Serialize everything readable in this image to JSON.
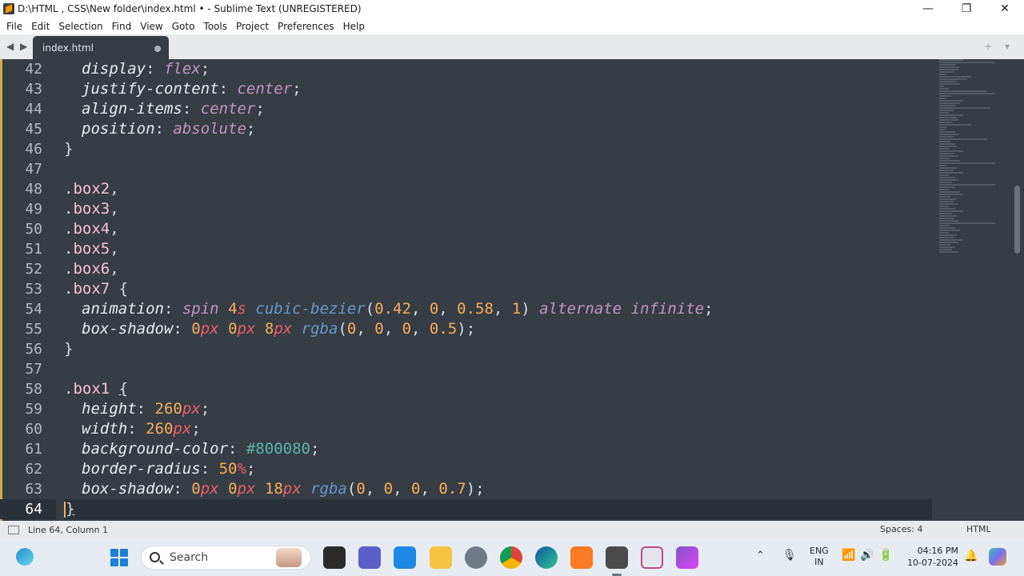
{
  "window": {
    "title": "D:\\HTML , CSS\\New folder\\index.html • - Sublime Text (UNREGISTERED)",
    "controls": {
      "minimize": "—",
      "maximize": "❐",
      "close": "✕"
    }
  },
  "menu": [
    "File",
    "Edit",
    "Selection",
    "Find",
    "View",
    "Goto",
    "Tools",
    "Project",
    "Preferences",
    "Help"
  ],
  "tabs": {
    "nav": "◀ ▶",
    "active_tab": "index.html",
    "right_controls": "+ ▾"
  },
  "editor": {
    "active_line": 64,
    "line_numbers": [
      "42",
      "43",
      "44",
      "45",
      "46",
      "47",
      "48",
      "49",
      "50",
      "51",
      "52",
      "53",
      "54",
      "55",
      "56",
      "57",
      "58",
      "59",
      "60",
      "61",
      "62",
      "63",
      "64"
    ]
  },
  "status": {
    "position": "Line 64, Column 1",
    "indentation": "Spaces: 4",
    "syntax": "HTML"
  },
  "taskbar": {
    "search_placeholder": "Search",
    "lang_top": "ENG",
    "lang_bottom": "IN",
    "time": "04:16 PM",
    "date": "10-07-2024",
    "apps": [
      "file-explorer-icon",
      "teams-icon",
      "store-icon",
      "folder-icon",
      "settings-icon",
      "chrome-icon",
      "edge-icon",
      "xampp-icon",
      "sublime-icon",
      "snipping-icon",
      "clapper-icon"
    ]
  },
  "colors": {
    "editor_bg": "#363d45",
    "keyword": "#c594c5",
    "number": "#f9ae58",
    "unit": "#ec5f67",
    "function": "#6699cc",
    "hex": "#5fb3b3",
    "selector": "#f8c3d3"
  }
}
